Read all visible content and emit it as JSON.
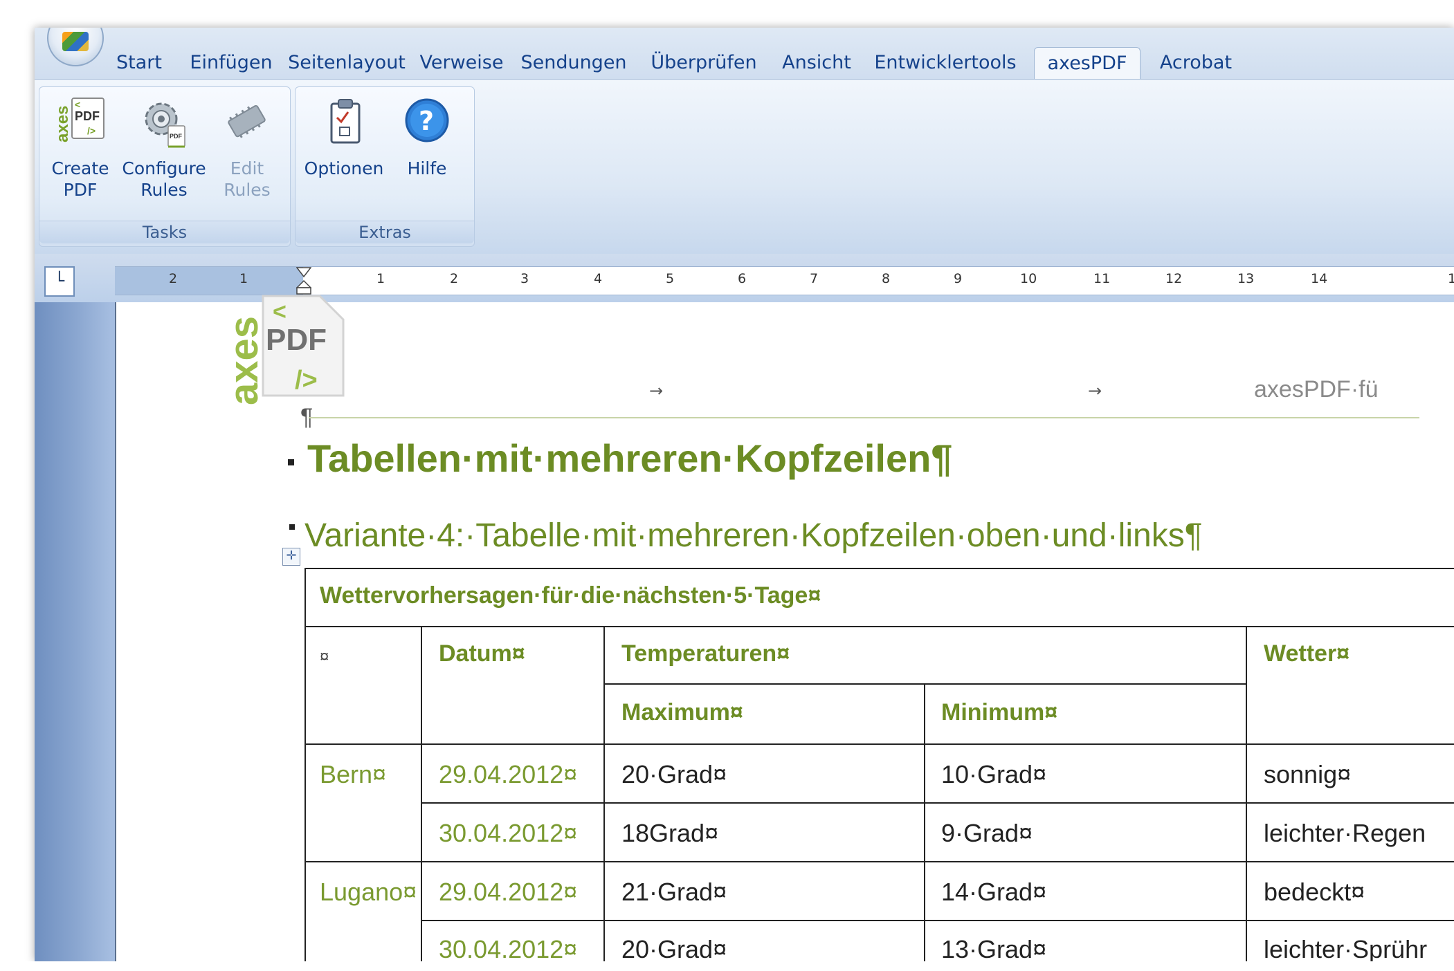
{
  "ribbon": {
    "tabs": [
      "Start",
      "Einfügen",
      "Seitenlayout",
      "Verweise",
      "Sendungen",
      "Überprüfen",
      "Ansicht",
      "Entwicklertools",
      "axesPDF",
      "Acrobat"
    ],
    "active_tab": "axesPDF",
    "groups": {
      "tasks": {
        "label": "Tasks",
        "create_pdf": {
          "line1": "Create",
          "line2": "PDF"
        },
        "configure_rules": {
          "line1": "Configure",
          "line2": "Rules"
        },
        "edit_rules": {
          "line1": "Edit",
          "line2": "Rules",
          "disabled": true
        }
      },
      "extras": {
        "label": "Extras",
        "optionen": "Optionen",
        "hilfe": "Hilfe"
      }
    }
  },
  "ruler": {
    "left_numbers": [
      "2",
      "1"
    ],
    "numbers": [
      "1",
      "2",
      "3",
      "4",
      "5",
      "6",
      "7",
      "8",
      "9",
      "10",
      "11",
      "12",
      "13",
      "14",
      "1"
    ]
  },
  "document": {
    "header": {
      "logo_word": "axes",
      "logo_pdf": "PDF",
      "logo_open": "<",
      "logo_close": "/>",
      "right_text": "axesPDF·fü",
      "pilcrow": "¶"
    },
    "heading1": "Tabellen·mit·mehreren·Kopfzeilen¶",
    "heading2": "Variante·4:·Tabelle·mit·mehreren·Kopfzeilen·oben·und·links¶",
    "table": {
      "caption": "Wettervorhersagen·für·die·nächsten·5·Tage¤",
      "corner": "¤",
      "col_datum": "Datum¤",
      "col_temperaturen": "Temperaturen¤",
      "col_maximum": "Maximum¤",
      "col_minimum": "Minimum¤",
      "col_wetter": "Wetter¤",
      "rows": [
        {
          "city": "Bern¤",
          "date": "29.04.2012¤",
          "max": "20·Grad¤",
          "min": "10·Grad¤",
          "wetter": "sonnig¤"
        },
        {
          "city": "",
          "date": "30.04.2012¤",
          "max": "18Grad¤",
          "min": "9·Grad¤",
          "wetter": "leichter·Regen"
        },
        {
          "city": "Lugano¤",
          "date": "29.04.2012¤",
          "max": "21·Grad¤",
          "min": "14·Grad¤",
          "wetter": "bedeckt¤"
        },
        {
          "city": "",
          "date": "30.04.2012¤",
          "max": "20·Grad¤",
          "min": "13·Grad¤",
          "wetter": "leichter·Sprühr"
        }
      ]
    }
  },
  "colors": {
    "heading_green": "#6c8c24",
    "ribbon_text": "#15428b",
    "ribbon_bg": "#dde8f5"
  }
}
